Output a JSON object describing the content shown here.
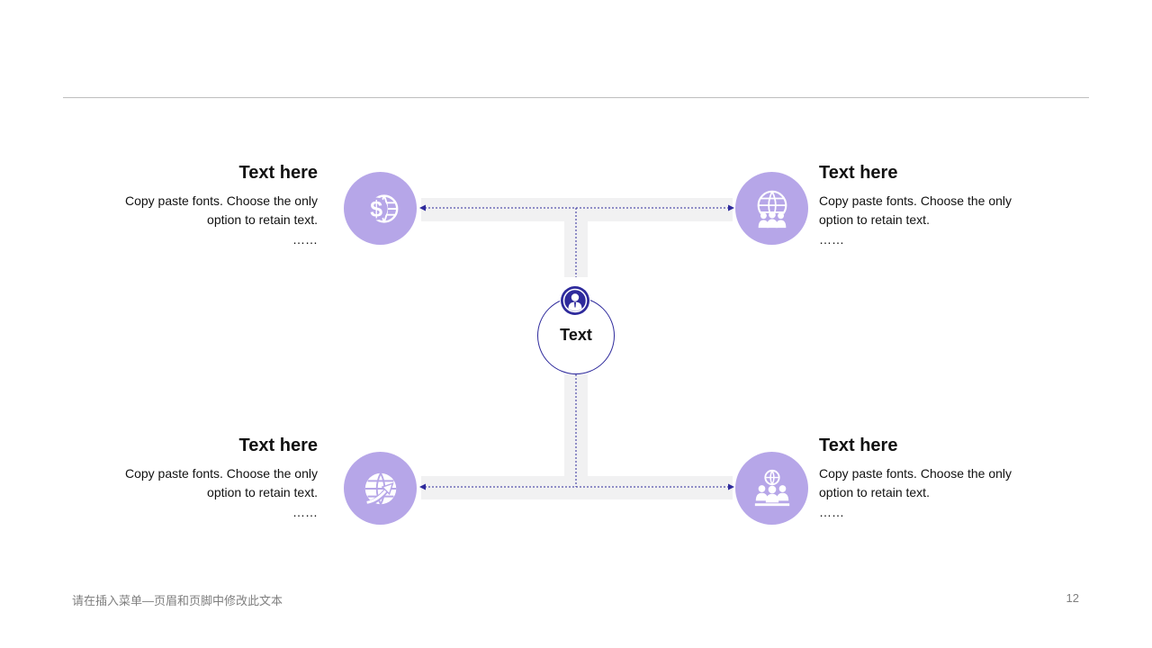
{
  "center": {
    "label": "Text",
    "icon": "person-icon"
  },
  "blocks": {
    "top_left": {
      "title": "Text here",
      "desc": "Copy paste fonts. Choose the only option to retain text.",
      "more": "……",
      "icon": "dollar-globe-icon"
    },
    "top_right": {
      "title": "Text here",
      "desc": "Copy paste fonts. Choose the only option to retain text.",
      "more": "……",
      "icon": "globe-people-icon"
    },
    "bottom_left": {
      "title": "Text here",
      "desc": "Copy paste fonts. Choose the only option to retain text.",
      "more": "……",
      "icon": "globe-arrow-icon"
    },
    "bottom_right": {
      "title": "Text here",
      "desc": "Copy paste fonts. Choose the only option to retain text.",
      "more": "……",
      "icon": "team-globe-icon"
    }
  },
  "footer": {
    "text": "请在插入菜单—页眉和页脚中修改此文本",
    "page_number": "12"
  },
  "colors": {
    "accent": "#b6a6e8",
    "line": "#2e2a9c",
    "track": "#f1f1f2",
    "rule": "#bfbfbf"
  }
}
